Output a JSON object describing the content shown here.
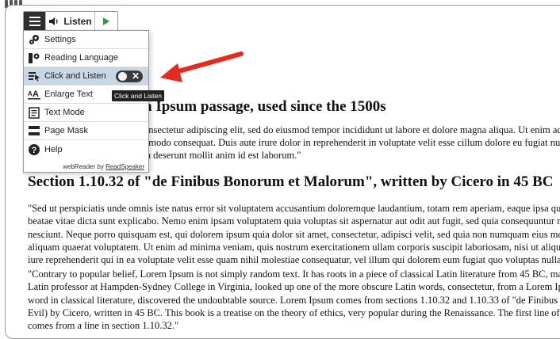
{
  "toolbar": {
    "menu_icon": "hamburger-icon",
    "listen_label": "Listen",
    "listen_icon": "speaker-icon",
    "play_icon": "play-icon",
    "accent": "#2e9b3c"
  },
  "menu": {
    "items": [
      {
        "label": "Settings",
        "icon": "gear-icon"
      },
      {
        "label": "Reading Language",
        "icon": "language-icon"
      },
      {
        "label": "Click and Listen",
        "icon": "click-listen-icon",
        "toggle": false
      },
      {
        "label": "Enlarge Text",
        "icon": "enlarge-text-icon"
      },
      {
        "label": "Text Mode",
        "icon": "text-mode-icon"
      },
      {
        "label": "Page Mask",
        "icon": "page-mask-icon"
      },
      {
        "label": "Help",
        "icon": "help-icon"
      }
    ],
    "footer_prefix": "webReader by",
    "footer_link": "ReadSpeaker"
  },
  "tooltip": "Click and Listen",
  "annotation": {
    "arrow_color": "#e52b1f"
  },
  "page": {
    "heading_1_visible": "n Ipsum passage, used since the 1500s",
    "para_1": [
      "onsectetur adipiscing elit, sed do eiusmod tempor incididunt ut labore et dolore magna aliqua. Ut enim ad m",
      "nmodo consequat. Duis aute irure dolor in reprehenderit in voluptate velit esse cillum dolore eu fugiat nulla",
      "ia deserunt mollit anim id est laborum.\""
    ],
    "heading_2": "Section 1.10.32 of \"de Finibus Bonorum et Malorum\", written by Cicero in 45 BC",
    "para_2": [
      "\"Sed ut perspiciatis unde omnis iste natus error sit voluptatem accusantium doloremque laudantium, totam rem aperiam, eaque ipsa quae a",
      "beatae vitae dicta sunt explicabo. Nemo enim ipsam voluptatem quia voluptas sit aspernatur aut odit aut fugit, sed quia consequuntur magn",
      "nesciunt. Neque porro quisquam est, qui dolorem ipsum quia dolor sit amet, consectetur, adipisci velit, sed quia non numquam eius modi t",
      "aliquam quaerat voluptatem. Ut enim ad minima veniam, quis nostrum exercitationem ullam corporis suscipit laboriosam, nisi ut aliquid ex",
      "iure reprehenderit qui in ea voluptate velit esse quam nihil molestiae consequatur, vel illum qui dolorem eum fugiat quo voluptas nulla par"
    ],
    "para_3": [
      "\"Contrary to popular belief, Lorem Ipsum is not simply random text. It has roots in a piece of classical Latin literature from 45 BC, makin",
      "Latin professor at Hampden-Sydney College in Virginia, looked up one of the more obscure Latin words, consectetur, from a Lorem Ipsun",
      "word in classical literature, discovered the undoubtable source. Lorem Ipsum comes from sections 1.10.32 and 1.10.33 of \"de Finibus Bon",
      "Evil) by Cicero, written in 45 BC. This book is a treatise on the theory of ethics, very popular during the Renaissance. The first line of Lor",
      "comes from a line in section 1.10.32.\""
    ]
  }
}
